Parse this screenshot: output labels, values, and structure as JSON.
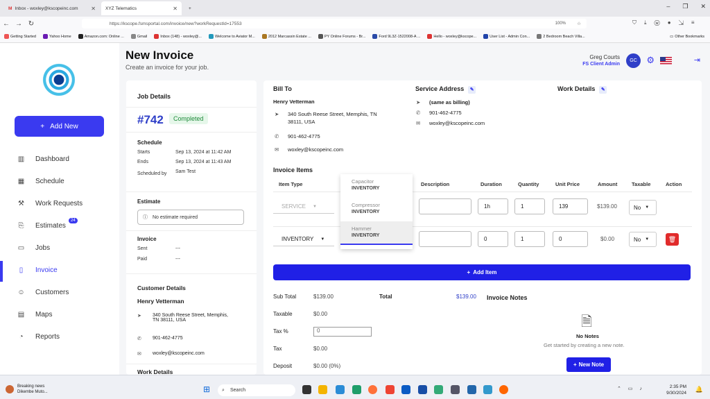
{
  "browser": {
    "tabs": [
      {
        "label": "Inbox - woxley@kscopeinc.com"
      },
      {
        "label": "XYZ Telematics"
      }
    ],
    "url": "https://kscope.fsmsportal.com/invoice/new?workRequestId=17553",
    "zoom": "100%",
    "bookmarks": [
      "Getting Started",
      "Yahoo Home",
      "Amazon.com: Online ...",
      "Gmail",
      "Inbox (148) - woxley@...",
      "Welcome to Aviator M...",
      "2012 Marcassin Estate ...",
      "PY Online Forums - Br...",
      "Ford 9L3Z-1522008-A ...",
      "Hello - woxley@kscope...",
      "User List - Admin Con...",
      "2 Bedroom Beach Villa..."
    ],
    "other_bookmarks": "Other Bookmarks"
  },
  "sidebar": {
    "add_new": "Add New",
    "items": [
      {
        "label": "Dashboard",
        "icon": "bar-chart-icon"
      },
      {
        "label": "Schedule",
        "icon": "calendar-icon"
      },
      {
        "label": "Work Requests",
        "icon": "wrench-icon"
      },
      {
        "label": "Estimates",
        "icon": "paperclip-icon",
        "badge": "24"
      },
      {
        "label": "Jobs",
        "icon": "folder-icon"
      },
      {
        "label": "Invoice",
        "icon": "document-icon"
      },
      {
        "label": "Customers",
        "icon": "users-icon"
      },
      {
        "label": "Maps",
        "icon": "map-icon"
      },
      {
        "label": "Reports",
        "icon": "chart-icon"
      }
    ]
  },
  "header": {
    "title": "New Invoice",
    "subtitle": "Create an invoice for your job.",
    "user_name": "Greg Courts",
    "user_role": "FS Client Admin",
    "avatar": "GC"
  },
  "job": {
    "section": "Job Details",
    "number": "#742",
    "status": "Completed",
    "schedule_title": "Schedule",
    "starts_label": "Starts",
    "starts": "Sep 13, 2024 at 11:42 AM",
    "ends_label": "Ends",
    "ends": "Sep 13, 2024 at 11:43 AM",
    "scheduled_by_label": "Scheduled by",
    "scheduled_by": "Sam Test",
    "estimate_title": "Estimate",
    "estimate_value": "No estimate required",
    "invoice_title": "Invoice",
    "sent_label": "Sent",
    "sent": "---",
    "paid_label": "Paid",
    "paid": "---",
    "customer_title": "Customer Details",
    "customer_name": "Henry Vetterman",
    "address_line1": "340 South Reese Street, Memphis,",
    "address_line2": "TN 38111, USA",
    "phone": "901-462-4775",
    "email": "woxley@kscopeinc.com",
    "work_details_title": "Work Details"
  },
  "bill_to": {
    "title": "Bill To",
    "name": "Henry Vetterman",
    "address_line1": "340 South Reese Street, Memphis, TN",
    "address_line2": "38111, USA",
    "phone": "901-462-4775",
    "email": "woxley@kscopeinc.com"
  },
  "service_address": {
    "title": "Service Address",
    "same": "(same as billing)",
    "phone": "901-462-4775",
    "email": "woxley@kscopeinc.com"
  },
  "work_details": {
    "title": "Work Details"
  },
  "items": {
    "title": "Invoice Items",
    "headers": [
      "Item Type",
      "Description",
      "Duration",
      "Quantity",
      "Unit Price",
      "Amount",
      "Taxable",
      "Action"
    ],
    "rows": [
      {
        "type": "SERVICE",
        "description": "",
        "duration": "1h",
        "quantity": "1",
        "unit_price": "139",
        "amount": "$139.00",
        "taxable": "No"
      },
      {
        "type": "INVENTORY",
        "description": "",
        "duration": "0",
        "quantity": "1",
        "unit_price": "0",
        "amount": "$0.00",
        "taxable": "No"
      }
    ],
    "dropdown": [
      {
        "name": "Capacitor",
        "kind": "INVENTORY"
      },
      {
        "name": "Compressor",
        "kind": "INVENTORY"
      },
      {
        "name": "Hammer",
        "kind": "INVENTORY"
      }
    ],
    "add_item": "Add Item"
  },
  "totals": {
    "subtotal_label": "Sub Total",
    "subtotal": "$139.00",
    "total_label": "Total",
    "total": "$139.00",
    "taxable_label": "Taxable",
    "taxable": "$0.00",
    "taxpct_label": "Tax %",
    "taxpct": "0",
    "tax_label": "Tax",
    "tax": "$0.00",
    "deposit_label": "Deposit",
    "deposit": "$0.00",
    "deposit_pct": "(0%)"
  },
  "notes": {
    "title": "Invoice Notes",
    "empty": "No Notes",
    "hint": "Get started by creating a new note.",
    "button": "New Note"
  },
  "taskbar": {
    "news_title": "Breaking news",
    "news_sub": "Dikembe Muto...",
    "search": "Search",
    "time": "2:35 PM",
    "date": "9/30/2024"
  }
}
